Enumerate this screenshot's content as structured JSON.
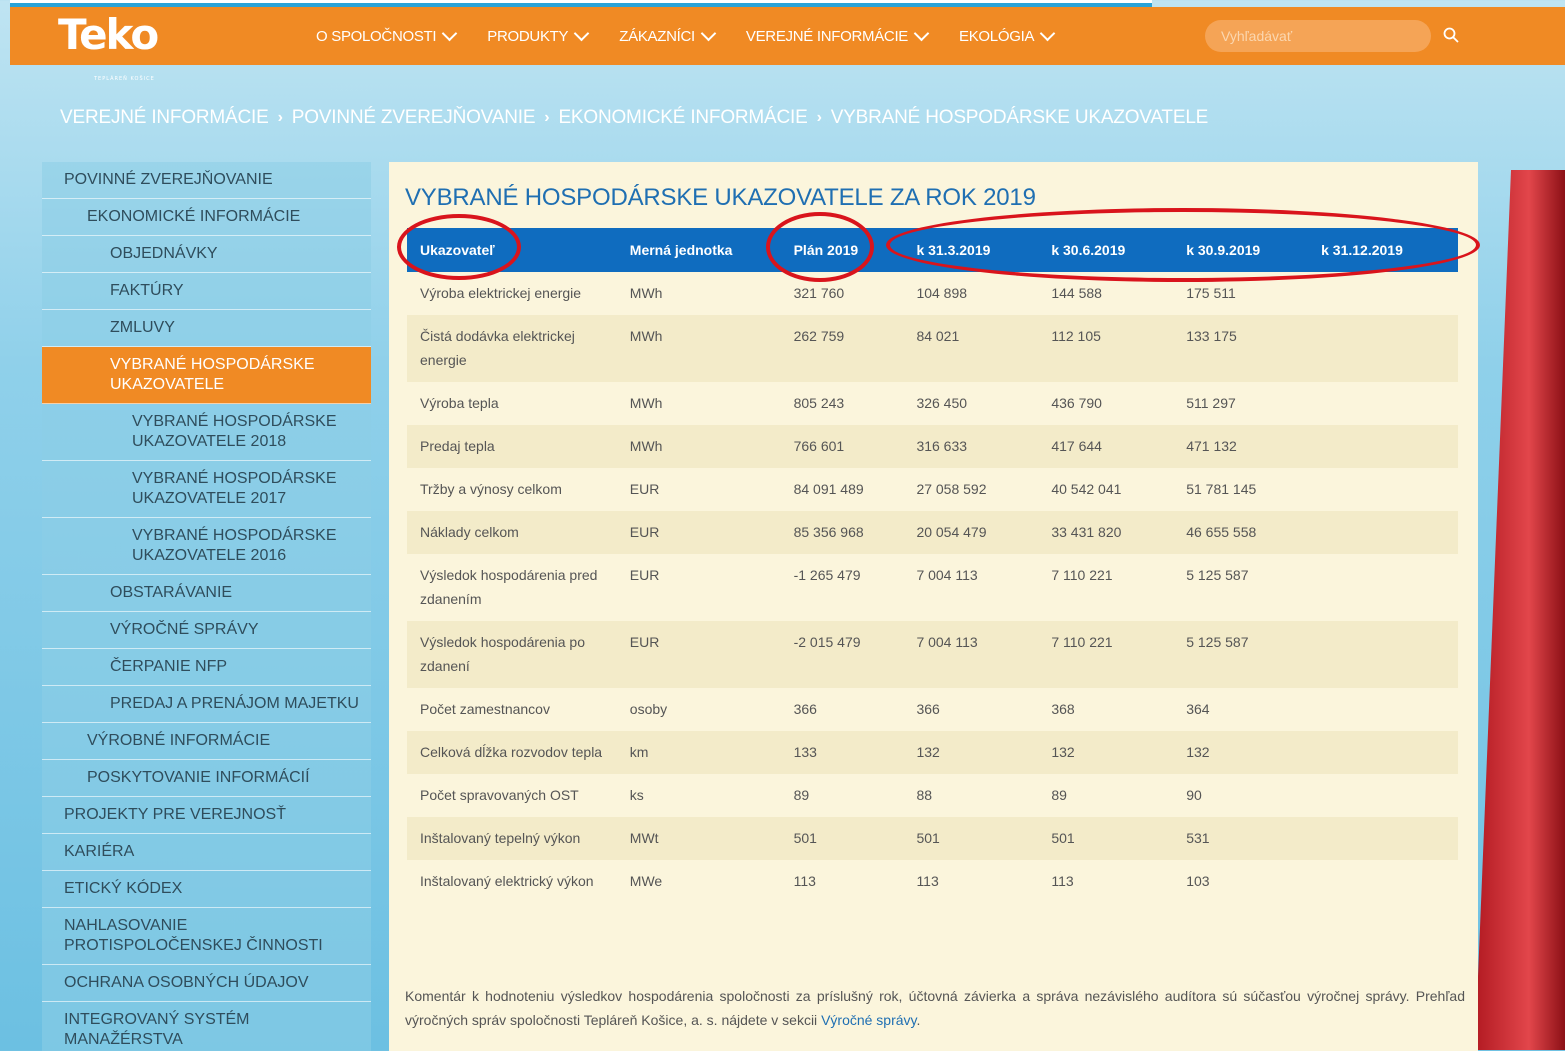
{
  "header": {
    "logo_text": "Teko",
    "logo_subtext": "TEPLÁREŇ KOŠICE",
    "nav": [
      {
        "label": "O SPOLOČNOSTI"
      },
      {
        "label": "PRODUKTY"
      },
      {
        "label": "ZÁKAZNÍCI"
      },
      {
        "label": "VEREJNÉ INFORMÁCIE"
      },
      {
        "label": "EKOLÓGIA"
      }
    ],
    "search_placeholder": "Vyhľadávať"
  },
  "breadcrumb": [
    "VEREJNÉ INFORMÁCIE",
    "POVINNÉ ZVEREJŇOVANIE",
    "EKONOMICKÉ INFORMÁCIE",
    "VYBRANÉ HOSPODÁRSKE UKAZOVATELE"
  ],
  "sidebar": [
    {
      "label": "POVINNÉ ZVEREJŇOVANIE",
      "level": 1
    },
    {
      "label": "EKONOMICKÉ INFORMÁCIE",
      "level": 2
    },
    {
      "label": "OBJEDNÁVKY",
      "level": 3
    },
    {
      "label": "FAKTÚRY",
      "level": 3
    },
    {
      "label": "ZMLUVY",
      "level": 3
    },
    {
      "label": "VYBRANÉ HOSPODÁRSKE UKAZOVATELE",
      "level": 3,
      "active": true
    },
    {
      "label": "VYBRANÉ HOSPODÁRSKE UKAZOVATELE 2018",
      "level": 4
    },
    {
      "label": "VYBRANÉ HOSPODÁRSKE UKAZOVATELE 2017",
      "level": 4
    },
    {
      "label": "VYBRANÉ HOSPODÁRSKE UKAZOVATELE 2016",
      "level": 4
    },
    {
      "label": "OBSTARÁVANIE",
      "level": 3
    },
    {
      "label": "VÝROČNÉ SPRÁVY",
      "level": 3
    },
    {
      "label": "ČERPANIE NFP",
      "level": 3
    },
    {
      "label": "PREDAJ A PRENÁJOM MAJETKU",
      "level": 3
    },
    {
      "label": "VÝROBNÉ INFORMÁCIE",
      "level": 2
    },
    {
      "label": "POSKYTOVANIE INFORMÁCIÍ",
      "level": 2
    },
    {
      "label": "PROJEKTY PRE VEREJNOSŤ",
      "level": 1
    },
    {
      "label": "KARIÉRA",
      "level": 1
    },
    {
      "label": "ETICKÝ KÓDEX",
      "level": 1
    },
    {
      "label": "NAHLASOVANIE PROTISPOLOČENSKEJ ČINNOSTI",
      "level": 1
    },
    {
      "label": "OCHRANA OSOBNÝCH ÚDAJOV",
      "level": 1
    },
    {
      "label": "INTEGROVANÝ SYSTÉM MANAŽÉRSTVA",
      "level": 1
    }
  ],
  "main": {
    "title": "VYBRANÉ HOSPODÁRSKE UKAZOVATELE ZA ROK 2019",
    "table": {
      "headers": [
        "Ukazovateľ",
        "Merná jednotka",
        "Plán 2019",
        "k 31.3.2019",
        "k 30.6.2019",
        "k 30.9.2019",
        "k 31.12.2019"
      ],
      "rows": [
        [
          "Výroba elektrickej energie",
          "MWh",
          "321 760",
          "104 898",
          "144 588",
          "175 511",
          ""
        ],
        [
          "Čistá dodávka elektrickej energie",
          "MWh",
          "262 759",
          "84 021",
          "112 105",
          "133 175",
          ""
        ],
        [
          "Výroba tepla",
          "MWh",
          "805 243",
          "326 450",
          "436 790",
          "511 297",
          ""
        ],
        [
          "Predaj tepla",
          "MWh",
          "766 601",
          "316 633",
          "417 644",
          "471 132",
          ""
        ],
        [
          "Tržby a výnosy celkom",
          "EUR",
          "84 091 489",
          "27 058 592",
          "40 542 041",
          "51 781 145",
          ""
        ],
        [
          "Náklady celkom",
          "EUR",
          "85 356 968",
          "20 054 479",
          "33 431 820",
          "46 655 558",
          ""
        ],
        [
          "Výsledok hospodárenia pred zdanením",
          "EUR",
          "-1 265 479",
          "7 004 113",
          "7 110 221",
          "5 125 587",
          ""
        ],
        [
          "Výsledok hospodárenia po zdanení",
          "EUR",
          "-2 015 479",
          "7 004 113",
          "7 110 221",
          "5 125 587",
          ""
        ],
        [
          "Počet zamestnancov",
          "osoby",
          "366",
          "366",
          "368",
          "364",
          ""
        ],
        [
          "Celková dĺžka rozvodov tepla",
          "km",
          "133",
          "132",
          "132",
          "132",
          ""
        ],
        [
          "Počet spravovaných OST",
          "ks",
          "89",
          "88",
          "89",
          "90",
          ""
        ],
        [
          "Inštalovaný tepelný výkon",
          "MWt",
          "501",
          "501",
          "501",
          "531",
          ""
        ],
        [
          "Inštalovaný elektrický výkon",
          "MWe",
          "113",
          "113",
          "113",
          "103",
          ""
        ]
      ]
    },
    "comment_text": "Komentár k hodnoteniu výsledkov hospodárenia spoločnosti za príslušný rok, účtovná závierka a správa nezávislého audítora sú súčasťou výročnej správy. Prehľad výročných správ spoločnosti Tepláreň Košice, a. s. nájdete v sekcii ",
    "comment_link": "Výročné správy",
    "comment_end": "."
  },
  "colors": {
    "header_orange": "#f08a24",
    "table_header_blue": "#0f6cbf",
    "title_blue": "#1f6fb2",
    "annotation_red": "#d9141c"
  }
}
